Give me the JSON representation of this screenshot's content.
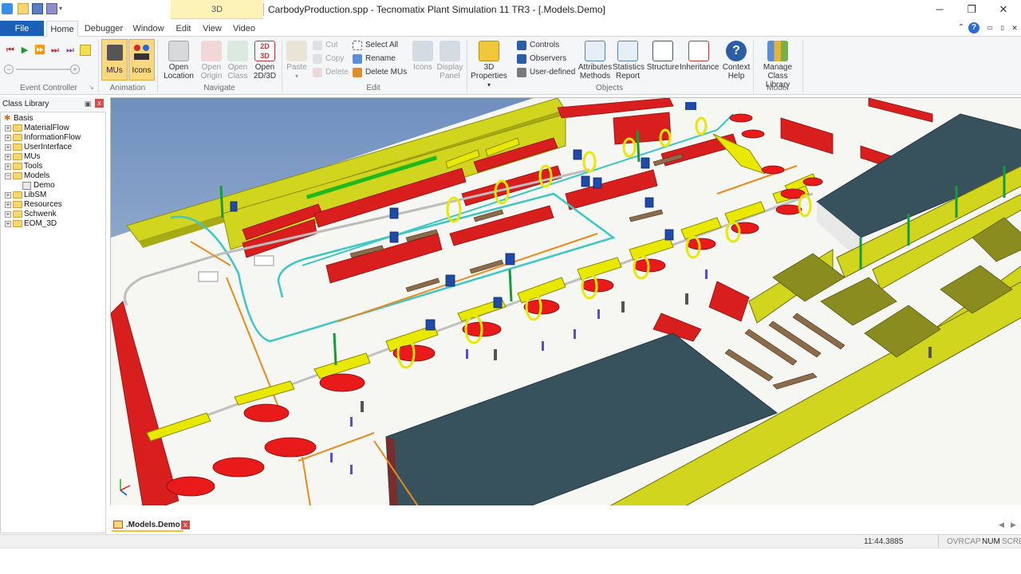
{
  "window": {
    "title": "CarbodyProduction.spp - Tecnomatix Plant Simulation 11 TR3 - [.Models.Demo]",
    "context_tab": "3D",
    "controls": {
      "minimize": "─",
      "maximize": "❐",
      "close": "✕"
    }
  },
  "tabs": [
    "File",
    "Home",
    "Debugger",
    "Window",
    "Edit",
    "View",
    "Video"
  ],
  "tab_icons": {
    "collapse": "⌃",
    "help": "?",
    "restore1": "▭",
    "restore2": "▯",
    "close": "✕"
  },
  "ribbon": {
    "event_controller": {
      "label": "Event Controller"
    },
    "animation": {
      "label": "Animation",
      "mus": "MUs",
      "icons": "Icons"
    },
    "navigate": {
      "label": "Navigate",
      "open_location": "Open Location",
      "open_origin": "Open Origin",
      "open_class": "Open Class",
      "open_2d3d": "Open 2D/3D"
    },
    "edit": {
      "label": "Edit",
      "paste": "Paste",
      "cut": "Cut",
      "copy": "Copy",
      "delete": "Delete",
      "select_all": "Select All",
      "rename": "Rename",
      "delete_mus": "Delete MUs",
      "icons": "Icons",
      "display_panel": "Display Panel"
    },
    "objects": {
      "label": "Objects",
      "properties_3d": "3D Properties",
      "controls": "Controls",
      "observers": "Observers",
      "user_defined": "User-defined",
      "attributes_methods": "Attributes Methods",
      "statistics_report": "Statistics Report",
      "structure": "Structure",
      "inheritance": "Inheritance",
      "context_help": "Context Help"
    },
    "model": {
      "label": "Model",
      "manage_class_library": "Manage Class Library"
    }
  },
  "class_library": {
    "title": "Class Library",
    "pin": "▣",
    "close": "x",
    "items": [
      {
        "label": "Basis",
        "level": 0
      },
      {
        "label": "MaterialFlow",
        "level": 1
      },
      {
        "label": "InformationFlow",
        "level": 1
      },
      {
        "label": "UserInterface",
        "level": 1
      },
      {
        "label": "MUs",
        "level": 1
      },
      {
        "label": "Tools",
        "level": 1
      },
      {
        "label": "Models",
        "level": 1
      },
      {
        "label": "Demo",
        "level": 2
      },
      {
        "label": "LibSM",
        "level": 1
      },
      {
        "label": "Resources",
        "level": 1
      },
      {
        "label": "Schwenk",
        "level": 1
      },
      {
        "label": "EOM_3D",
        "level": 1
      }
    ]
  },
  "document_tab": {
    "label": ".Models.Demo",
    "close": "x"
  },
  "status": {
    "time": "11:44.3885",
    "indicators": [
      "OVR",
      "CAP",
      "NUM",
      "SCRL"
    ],
    "active_indicator": "NUM"
  },
  "colors": {
    "file_tab": "#1c5fb5",
    "toggle_active": "#fbd87f",
    "rack_red": "#d91e1e",
    "wall_yellow": "#d2d51e",
    "roof_slate": "#37525c",
    "sky": "#8aa7cc",
    "floor": "#f7f7f4",
    "car_red": "#e81a1a",
    "conveyor_cyan": "#3ec7c4",
    "beam_orange": "#e88c1e"
  }
}
